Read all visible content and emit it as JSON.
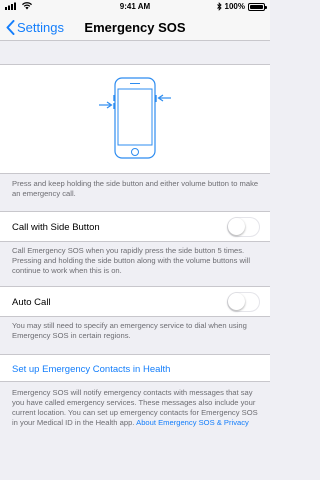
{
  "status_bar": {
    "time": "9:41 AM",
    "battery": "100%",
    "signal_icon": "signal-bars-icon",
    "wifi_icon": "wifi-icon",
    "bluetooth_icon": "bluetooth-icon",
    "battery_icon": "battery-full-icon"
  },
  "nav": {
    "back_label": "Settings",
    "title": "Emergency SOS"
  },
  "illustration": {
    "icon": "phone-side-buttons-icon"
  },
  "description": "Press and keep holding the side button and either volume button to make an emergency call.",
  "call_with_side_button": {
    "label": "Call with Side Button",
    "enabled": false,
    "footer": "Call Emergency SOS when you rapidly press the side button 5 times. Pressing and holding the side button along with the volume buttons will continue to work when this is on."
  },
  "auto_call": {
    "label": "Auto Call",
    "enabled": false,
    "footer": "You may still need to specify an emergency service to dial when using Emergency SOS in certain regions."
  },
  "contacts": {
    "link_label": "Set up Emergency Contacts in Health",
    "footer": "Emergency SOS will notify emergency contacts with messages that say you have called emergency services. These messages also include your current location. You can set up emergency contacts for Emergency SOS in your Medical ID in the Health app.",
    "about_link": "About Emergency SOS & Privacy"
  },
  "colors": {
    "accent": "#147efb",
    "background": "#efeff4",
    "footer_text": "#6d6d72",
    "separator": "#c8c7cc"
  }
}
